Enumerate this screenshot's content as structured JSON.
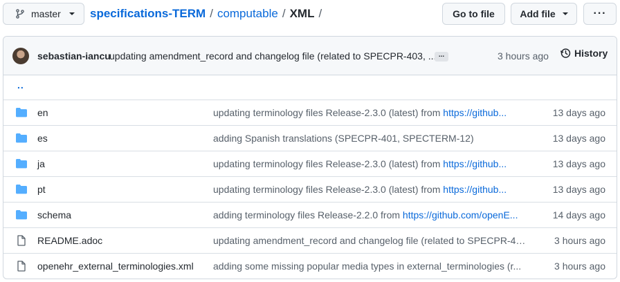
{
  "header": {
    "branch": "master",
    "repo": "specifications-TERM",
    "path": [
      "computable",
      "XML"
    ],
    "goto_file": "Go to file",
    "add_file": "Add file",
    "more": "···"
  },
  "latest_commit": {
    "author": "sebastian-iancu",
    "message": "updating amendment_record and changelog file (related to SPECPR-403, ...",
    "ellipsis": "...",
    "time": "3 hours ago",
    "history_label": "History"
  },
  "parent_dir": "..",
  "files": [
    {
      "type": "dir",
      "name": "en",
      "message": "updating terminology files Release-2.3.0 (latest) from ",
      "url": "https://github...",
      "time": "13 days ago"
    },
    {
      "type": "dir",
      "name": "es",
      "message": "adding Spanish translations (SPECPR-401, SPECTERM-12)",
      "url": "",
      "time": "13 days ago"
    },
    {
      "type": "dir",
      "name": "ja",
      "message": "updating terminology files Release-2.3.0 (latest) from ",
      "url": "https://github...",
      "time": "13 days ago"
    },
    {
      "type": "dir",
      "name": "pt",
      "message": "updating terminology files Release-2.3.0 (latest) from ",
      "url": "https://github...",
      "time": "13 days ago"
    },
    {
      "type": "dir",
      "name": "schema",
      "message": "adding terminology files Release-2.2.0 from ",
      "url": "https://github.com/openE...",
      "time": "14 days ago"
    },
    {
      "type": "file",
      "name": "README.adoc",
      "message": "updating amendment_record and changelog file (related to SPECPR-40...",
      "url": "",
      "time": "3 hours ago"
    },
    {
      "type": "file",
      "name": "openehr_external_terminologies.xml",
      "message": "adding some missing popular media types in external_terminologies (r...",
      "url": "",
      "time": "3 hours ago"
    }
  ],
  "colors": {
    "accent": "#0969da",
    "folder": "#54aeff",
    "muted": "#57606a"
  }
}
